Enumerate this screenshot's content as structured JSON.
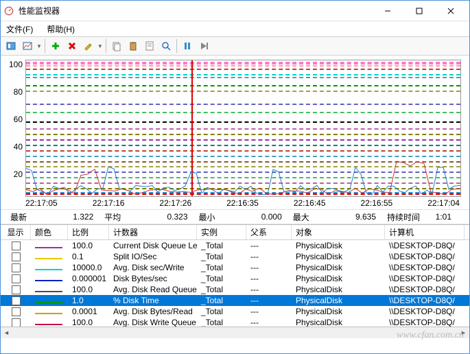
{
  "window": {
    "title": "性能监视器"
  },
  "menu": {
    "file": "文件(F)",
    "help": "帮助(H)"
  },
  "chart": {
    "y_ticks": [
      "100",
      "80",
      "60",
      "40",
      "20",
      ""
    ],
    "x_ticks": [
      "22:17:05",
      "22:17:16",
      "22:17:26",
      "22:16:35",
      "22:16:45",
      "22:16:55",
      "22:17:04"
    ]
  },
  "stats": {
    "latest_label": "最新",
    "latest": "1.322",
    "avg_label": "平均",
    "avg": "0.323",
    "min_label": "最小",
    "min": "0.000",
    "max_label": "最大",
    "max": "9.635",
    "duration_label": "持续时间",
    "duration": "1:01"
  },
  "columns": {
    "show": "显示",
    "color": "颜色",
    "scale": "比例",
    "counter": "计数器",
    "instance": "实例",
    "parent": "父系",
    "object": "对象",
    "computer": "计算机"
  },
  "rows": [
    {
      "checked": false,
      "color": "#9b30a0",
      "scale": "100.0",
      "counter": "Current Disk Queue Le...",
      "instance": "_Total",
      "parent": "---",
      "object": "PhysicalDisk",
      "computer": "\\\\DESKTOP-D8Q/"
    },
    {
      "checked": false,
      "color": "#e6c800",
      "scale": "0.1",
      "counter": "Split IO/Sec",
      "instance": "_Total",
      "parent": "---",
      "object": "PhysicalDisk",
      "computer": "\\\\DESKTOP-D8Q/"
    },
    {
      "checked": false,
      "color": "#00d0d0",
      "scale": "10000.0",
      "counter": "Avg. Disk sec/Write",
      "instance": "_Total",
      "parent": "---",
      "object": "PhysicalDisk",
      "computer": "\\\\DESKTOP-D8Q/"
    },
    {
      "checked": false,
      "color": "#0020c0",
      "scale": "0.000001",
      "counter": "Disk Bytes/sec",
      "instance": "_Total",
      "parent": "---",
      "object": "PhysicalDisk",
      "computer": "\\\\DESKTOP-D8Q/"
    },
    {
      "checked": false,
      "color": "#4a4a4a",
      "scale": "100.0",
      "counter": "Avg. Disk Read Queue ...",
      "instance": "_Total",
      "parent": "---",
      "object": "PhysicalDisk",
      "computer": "\\\\DESKTOP-D8Q/"
    },
    {
      "checked": true,
      "color": "#009a00",
      "scale": "1.0",
      "counter": "% Disk Time",
      "instance": "_Total",
      "parent": "---",
      "object": "PhysicalDisk",
      "computer": "\\\\DESKTOP-D8Q/",
      "selected": true
    },
    {
      "checked": false,
      "color": "#d0a000",
      "scale": "0.0001",
      "counter": "Avg. Disk Bytes/Read",
      "instance": "_Total",
      "parent": "---",
      "object": "PhysicalDisk",
      "computer": "\\\\DESKTOP-D8Q/"
    },
    {
      "checked": false,
      "color": "#c00050",
      "scale": "100.0",
      "counter": "Avg. Disk Write Queue ...",
      "instance": "_Total",
      "parent": "---",
      "object": "PhysicalDisk",
      "computer": "\\\\DESKTOP-D8Q/"
    }
  ],
  "chart_data": {
    "type": "line",
    "title": "",
    "ylim": [
      0,
      100
    ],
    "note": "Multiple overlapping performance-counter traces; values are approximate readings from pixels.",
    "series": [
      {
        "name": "top-band-pink",
        "color": "#ff77cc",
        "approx_constant": 98
      },
      {
        "name": "cyan-high",
        "color": "#00d0d0",
        "approx_constant": 90
      },
      {
        "name": "green-dash",
        "color": "#009a00",
        "approx_constant": 82
      },
      {
        "name": "black-mid",
        "color": "#000000",
        "approx_constant": 55
      },
      {
        "name": "purple",
        "color": "#9b30a0",
        "approx_constant": 42
      },
      {
        "name": "brown-dash",
        "color": "#8a5a2a",
        "approx_constant": 26
      },
      {
        "name": "red-spikes",
        "color": "#d00000",
        "approx_constant": 2
      },
      {
        "name": "baseline-noise",
        "color": "#3080d0",
        "approx_constant": 3
      }
    ],
    "cursor_x_fraction": 0.38
  },
  "watermark": "www.cfan.com.cn"
}
